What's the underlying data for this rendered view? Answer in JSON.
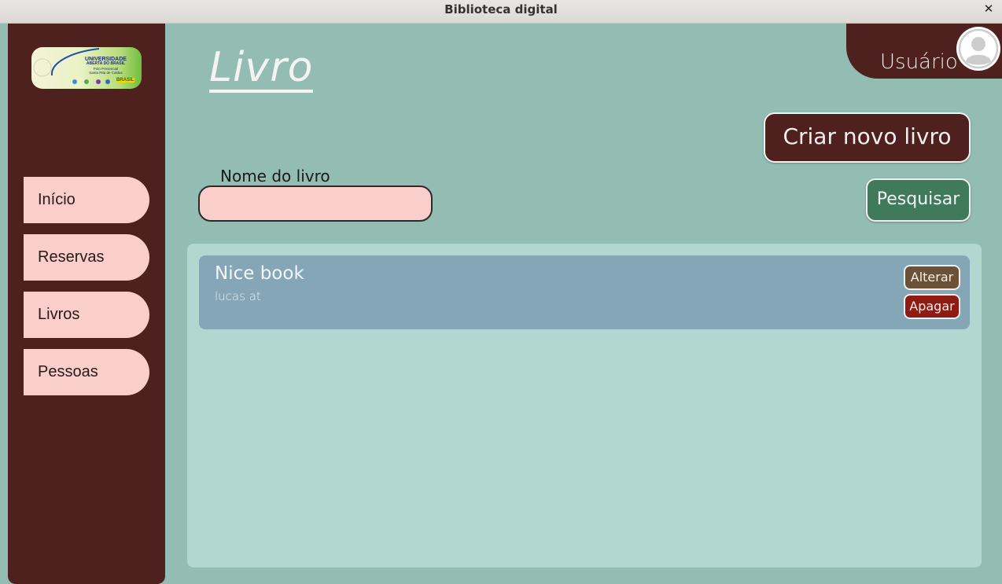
{
  "window": {
    "title": "Biblioteca digital",
    "close_icon": "close-icon"
  },
  "logo": {
    "line1": "UNIVERSIDADE",
    "line2": "ABERTA DO BRASIL",
    "line3": "Polo Presencial",
    "line4": "Santa Rita de Caldas",
    "brasil": "BRASIL"
  },
  "sidebar": {
    "items": [
      {
        "label": "Início"
      },
      {
        "label": "Reservas"
      },
      {
        "label": "Livros"
      },
      {
        "label": "Pessoas"
      }
    ]
  },
  "user": {
    "label": "Usuário",
    "icon": "user-avatar-icon"
  },
  "page": {
    "title": "Livro",
    "create_button": "Criar novo livro"
  },
  "search": {
    "label": "Nome do livro",
    "value": "",
    "placeholder": "",
    "button": "Pesquisar"
  },
  "books": [
    {
      "title": "Nice book",
      "author": "lucas at",
      "edit_label": "Alterar",
      "delete_label": "Apagar"
    }
  ],
  "colors": {
    "background": "#93bcb3",
    "sidebar": "#4e201e",
    "nav_item": "#f9cecb",
    "results_panel": "#b2d7d0",
    "book_card": "#84a6b6",
    "search_button": "#3f7a5b",
    "edit_button": "#6b5138",
    "delete_button": "#8e1c12"
  }
}
